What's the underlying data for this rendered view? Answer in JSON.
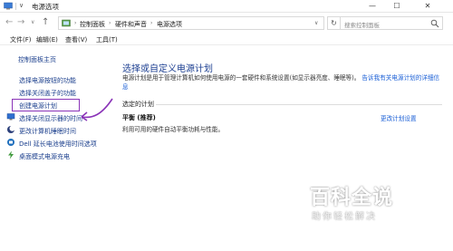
{
  "window": {
    "title": "电源选项",
    "min_glyph": "—",
    "max_glyph": "☐",
    "close_glyph": "✕"
  },
  "nav": {
    "back_glyph": "←",
    "forward_glyph": "→",
    "history_glyph": "∨",
    "up_glyph": "↑",
    "refresh_glyph": "↻",
    "dropdown_glyph": "∨"
  },
  "breadcrumb": {
    "items": [
      "控制面板",
      "硬件和声音",
      "电源选项"
    ],
    "separator": "›"
  },
  "search": {
    "placeholder": "搜索控制面板"
  },
  "menu": [
    "文件(F)",
    "编辑(E)",
    "查看(V)",
    "工具(T)"
  ],
  "sidebar": {
    "home": "控制面板主页",
    "items": [
      {
        "label": "选择电源按钮的功能"
      },
      {
        "label": "选择关闭盖子的功能"
      },
      {
        "label": "创建电源计划"
      },
      {
        "label": "选择关闭显示器的时间",
        "icon": "monitor-power-icon"
      },
      {
        "label": "更改计算机睡眠时间",
        "icon": "moon-sleep-icon"
      },
      {
        "label": "Dell 延长电池使用时间选项",
        "icon": "battery-icon"
      },
      {
        "label": "桌面模式电源充电",
        "icon": "charge-icon"
      }
    ]
  },
  "main": {
    "title": "选择或自定义电源计划",
    "desc_text": "电源计划是用于管理计算机如何使用电源的一套硬件和系统设置(如显示器亮度、睡眠等)。",
    "desc_link": "告诉我有关电源计划的详细信息",
    "section_label": "选定的计划",
    "plan_name": "平衡 (推荐)",
    "plan_desc": "利用可用的硬件自动平衡功耗与性能。",
    "plan_link": "更改计划设置"
  },
  "watermark": {
    "title": "百科全说",
    "subtitle": "助你轻松解决"
  },
  "colors": {
    "link": "#1a3e8c",
    "highlight_box": "#8a33b8",
    "title_blue": "#1c3f91"
  }
}
